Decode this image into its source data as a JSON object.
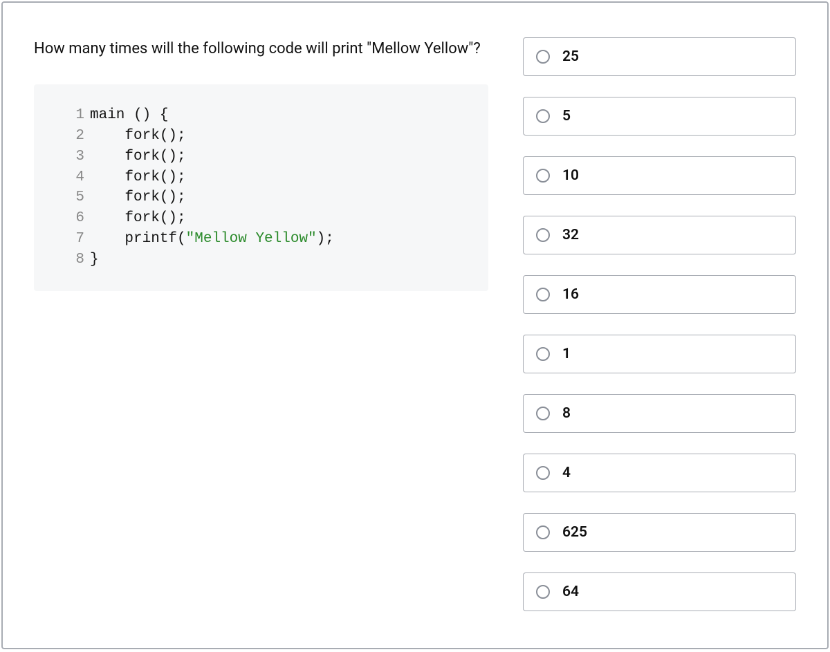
{
  "question": {
    "text": "How many times will the following code will print \"Mellow Yellow\"?",
    "code_lines": [
      {
        "num": "1",
        "text": "main () {",
        "indent": ""
      },
      {
        "num": "2",
        "text": "fork();",
        "indent": "    "
      },
      {
        "num": "3",
        "text": "fork();",
        "indent": "    "
      },
      {
        "num": "4",
        "text": "fork();",
        "indent": "    "
      },
      {
        "num": "5",
        "text": "fork();",
        "indent": "    "
      },
      {
        "num": "6",
        "text": "fork();",
        "indent": "    "
      },
      {
        "num": "7",
        "text_pre": "printf(",
        "text_string": "\"Mellow Yellow\"",
        "text_post": ");",
        "indent": "    "
      },
      {
        "num": "8",
        "text": "}",
        "indent": ""
      }
    ]
  },
  "options": [
    {
      "label": "25"
    },
    {
      "label": "5"
    },
    {
      "label": "10"
    },
    {
      "label": "32"
    },
    {
      "label": "16"
    },
    {
      "label": "1"
    },
    {
      "label": "8"
    },
    {
      "label": "4"
    },
    {
      "label": "625"
    },
    {
      "label": "64"
    }
  ]
}
